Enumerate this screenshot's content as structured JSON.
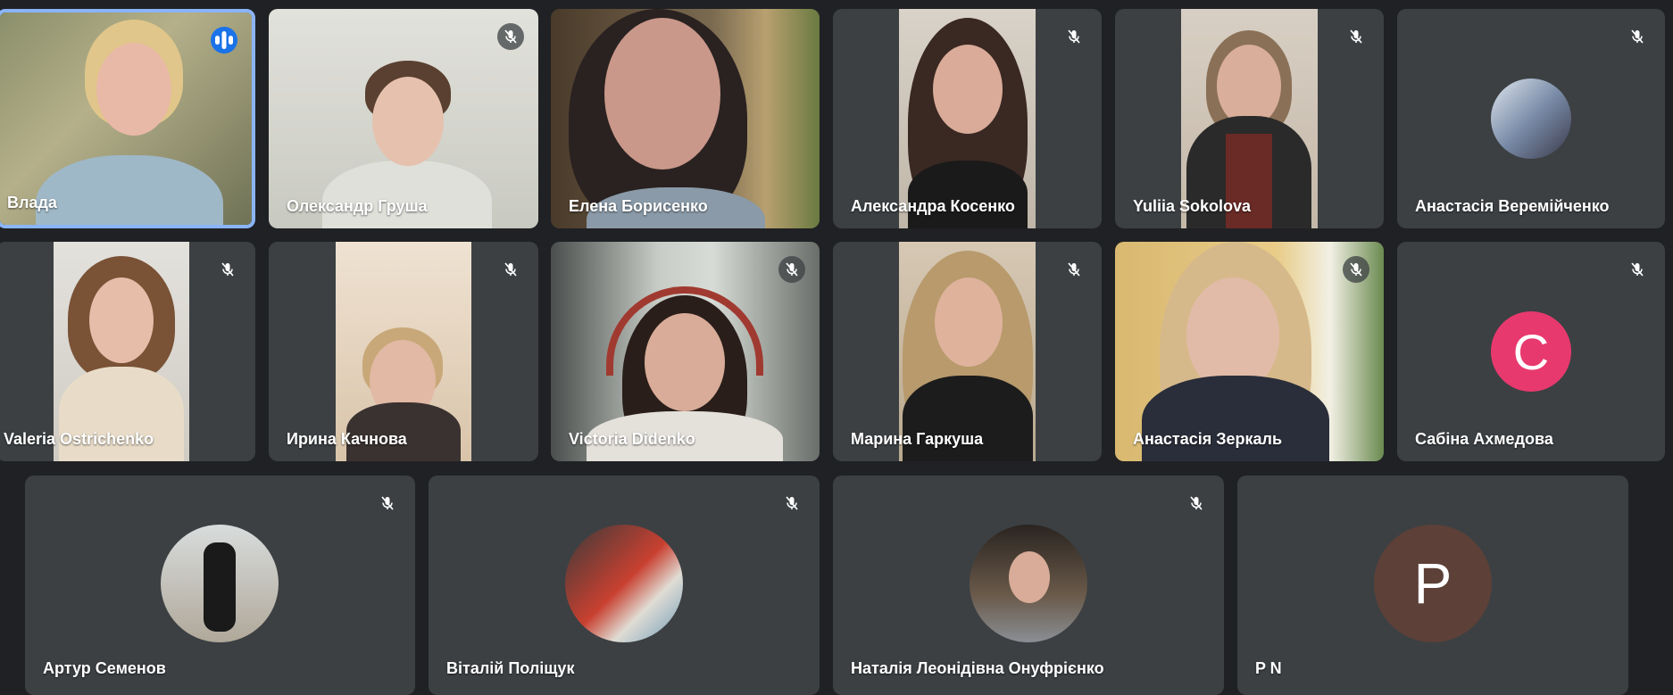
{
  "participants": [
    {
      "name": "Влада"
    },
    {
      "name": "Олександр Груша"
    },
    {
      "name": "Елена Борисенко"
    },
    {
      "name": "Александра Косенко"
    },
    {
      "name": "Yuliia Sokolova"
    },
    {
      "name": "Анастасія Веремійченко"
    },
    {
      "name": "Valeria Ostrichenko"
    },
    {
      "name": "Ирина Качнова"
    },
    {
      "name": "Victoria Didenko"
    },
    {
      "name": "Марина Гаркуша"
    },
    {
      "name": "Анастасія Зеркаль"
    },
    {
      "name": "Сабіна Ахмедова",
      "avatar_letter": "C",
      "avatar_color": "#e8396e"
    },
    {
      "name": "Артур Семенов"
    },
    {
      "name": "Віталій Поліщук"
    },
    {
      "name": "Наталія Леонідівна Онуфрієнко"
    },
    {
      "name": "P N",
      "avatar_letter": "P",
      "avatar_color": "#5d4037"
    }
  ],
  "colors": {
    "background": "#202124",
    "tile": "#3c4043",
    "active_border": "#8ab4f8",
    "speaking_indicator": "#1a73e8"
  },
  "icons": {
    "muted": "mic-off-icon",
    "speaking": "audio-wave-icon"
  }
}
